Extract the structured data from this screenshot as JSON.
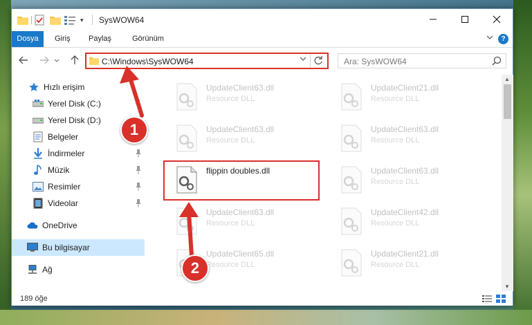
{
  "window": {
    "title": "SysWOW64",
    "quick_access_dropdown": "▾"
  },
  "ribbon": {
    "tabs": [
      "Dosya",
      "Giriş",
      "Paylaş",
      "Görünüm"
    ],
    "file_tab_color": "#1979ca"
  },
  "address_bar": {
    "path": "C:\\Windows\\SysWOW64",
    "highlight_color": "#d9302a"
  },
  "search": {
    "placeholder": "Ara: SysWOW64"
  },
  "nav_pane": {
    "items": [
      {
        "label": "Hızlı erişim",
        "icon": "star-icon"
      },
      {
        "label": "Yerel Disk (C:)",
        "icon": "drive-icon",
        "pinned": true
      },
      {
        "label": "Yerel Disk (D:)",
        "icon": "drive-icon",
        "pinned": false
      },
      {
        "label": "Belgeler",
        "icon": "documents-icon",
        "pinned": true
      },
      {
        "label": "İndirmeler",
        "icon": "download-icon",
        "pinned": true
      },
      {
        "label": "Müzik",
        "icon": "music-icon",
        "pinned": true
      },
      {
        "label": "Resimler",
        "icon": "pictures-icon",
        "pinned": true
      },
      {
        "label": "Videolar",
        "icon": "videos-icon",
        "pinned": true
      },
      {
        "label": "OneDrive",
        "icon": "onedrive-icon"
      },
      {
        "label": "Bu bilgisayar",
        "icon": "computer-icon",
        "selected": true
      },
      {
        "label": "Ağ",
        "icon": "network-icon"
      }
    ]
  },
  "files": [
    {
      "name": "UpdateClient63.dll",
      "type": "Resource DLL"
    },
    {
      "name": "UpdateClient21.dll",
      "type": "Resource DLL"
    },
    {
      "name": "UpdateClient63.dll",
      "type": "Resource DLL"
    },
    {
      "name": "UpdateClient63.dll",
      "type": "Resource DLL"
    },
    {
      "name": "flippin doubles.dll",
      "type": ""
    },
    {
      "name": "UpdateClient63.dll",
      "type": "Resource DLL"
    },
    {
      "name": "UpdateClient63.dll",
      "type": "Resource DLL"
    },
    {
      "name": "UpdateClient42.dll",
      "type": "Resource DLL"
    },
    {
      "name": "UpdateClient65.dll",
      "type": "Resource DLL"
    },
    {
      "name": "UpdateClient21.dll",
      "type": "Resource DLL"
    }
  ],
  "status": {
    "item_count": "189 öğe"
  },
  "annotations": {
    "step1": "1",
    "step2": "2",
    "color": "#d9302a"
  }
}
